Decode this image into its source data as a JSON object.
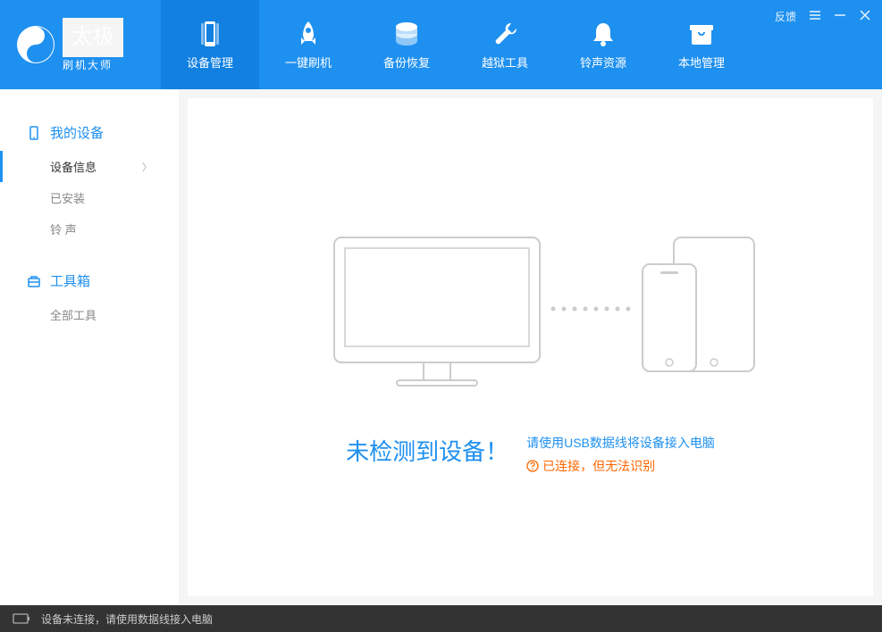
{
  "app": {
    "name_main": "太极",
    "name_sub": "刷机大师"
  },
  "window": {
    "feedback": "反馈"
  },
  "nav": {
    "items": [
      {
        "label": "设备管理"
      },
      {
        "label": "一键刷机"
      },
      {
        "label": "备份恢复"
      },
      {
        "label": "越狱工具"
      },
      {
        "label": "铃声资源"
      },
      {
        "label": "本地管理"
      }
    ]
  },
  "sidebar": {
    "sections": [
      {
        "title": "我的设备",
        "items": [
          {
            "label": "设备信息"
          },
          {
            "label": "已安装"
          },
          {
            "label": "铃 声"
          }
        ]
      },
      {
        "title": "工具箱",
        "items": [
          {
            "label": "全部工具"
          }
        ]
      }
    ]
  },
  "main": {
    "no_device_title": "未检测到设备！",
    "usb_hint": "请使用USB数据线将设备接入电脑",
    "connected_warn": "已连接，但无法识别"
  },
  "footer": {
    "status": "设备未连接，请使用数据线接入电脑"
  }
}
